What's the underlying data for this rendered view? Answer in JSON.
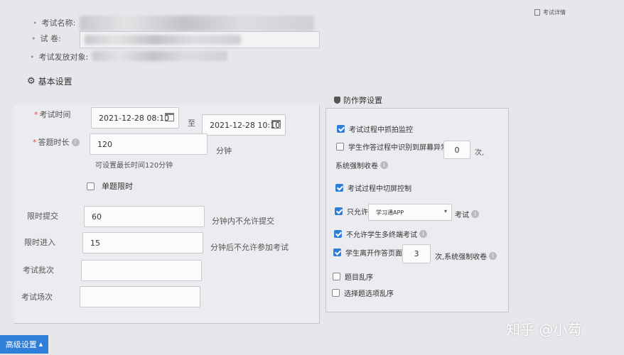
{
  "top_link": {
    "label": "考试详情"
  },
  "header_fields": {
    "exam_name_label": "考试名称:",
    "paper_label": "试 卷:",
    "target_label": "考试发放对象:"
  },
  "basic_settings": {
    "title": "基本设置",
    "exam_time_label": "考试时间",
    "start_time": "2021-12-28 08:10",
    "to_label": "至",
    "end_time": "2021-12-28 10:10",
    "duration_label": "答题时长",
    "duration_value": "120",
    "duration_unit": "分钟",
    "duration_hint": "可设置最长时间120分钟",
    "single_limit_label": "单题限时",
    "single_limit_checked": false,
    "submit_limit_label": "限时提交",
    "submit_limit_value": "60",
    "submit_limit_suffix": "分钟内不允许提交",
    "entry_limit_label": "限时进入",
    "entry_limit_value": "15",
    "entry_limit_suffix": "分钟后不允许参加考试",
    "batch_label": "考试批次",
    "batch_value": "",
    "session_label": "考试场次",
    "session_value": ""
  },
  "anti_cheat": {
    "title": "防作弊设置",
    "monitor_label": "考试过程中抓拍监控",
    "monitor_checked": true,
    "abnormal_label": "学生作答过程中识别到屏幕异常",
    "abnormal_checked": false,
    "abnormal_value": "0",
    "abnormal_suffix": "次,",
    "abnormal_line2": "系统强制收卷",
    "switch_label": "考试过程中切屏控制",
    "switch_checked": true,
    "only_allow_label": "只允许",
    "only_allow_checked": true,
    "only_allow_option": "学习通APP",
    "only_allow_suffix": "考试",
    "multi_device_label": "不允许学生多终端考试",
    "multi_device_checked": true,
    "leave_label": "学生离开作答页面",
    "leave_checked": true,
    "leave_value": "3",
    "leave_suffix": "次,系统强制收卷",
    "shuffle_q_label": "题目乱序",
    "shuffle_q_checked": false,
    "shuffle_opt_label": "选择题选项乱序",
    "shuffle_opt_checked": false
  },
  "advanced_button": {
    "label": "高级设置"
  },
  "watermark": {
    "text": "知乎 @小芶"
  },
  "colors": {
    "accent": "#2f7ed8",
    "required": "#d9534f"
  }
}
